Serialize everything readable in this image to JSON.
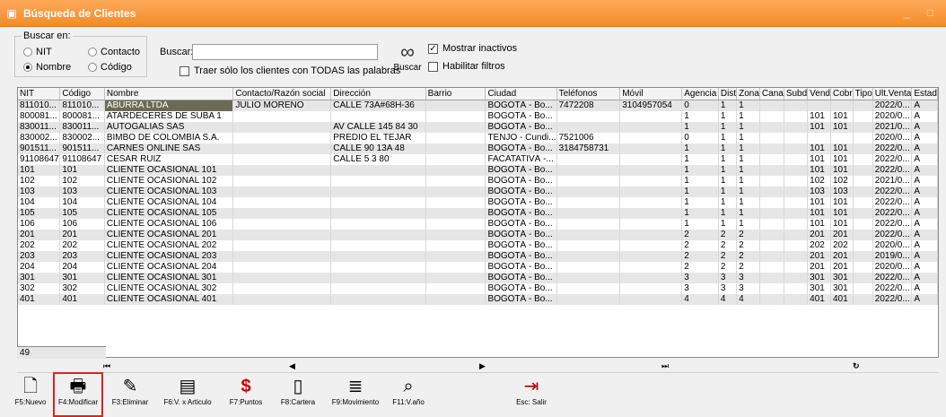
{
  "window": {
    "title": "Búsqueda de Clientes",
    "title_icon": "app-icon"
  },
  "search_panel": {
    "group_label": "Buscar en:",
    "options": [
      {
        "label": "NIT",
        "selected": false
      },
      {
        "label": "Nombre",
        "selected": true
      },
      {
        "label": "Contacto",
        "selected": false
      },
      {
        "label": "Código",
        "selected": false
      }
    ],
    "search_label": "Buscar:",
    "search_value": "",
    "all_words_label": "Traer sólo los clientes con TODAS las palabras",
    "search_button_label": "Buscar",
    "show_inactive_label": "Mostrar inactivos",
    "show_inactive_checked": true,
    "enable_filters_label": "Habilitar filtros",
    "enable_filters_checked": false
  },
  "grid": {
    "columns": [
      "NIT",
      "Código",
      "Nombre",
      "Contacto/Razón social",
      "Dirección",
      "Barrio",
      "Ciudad",
      "Teléfonos",
      "Móvil",
      "Agencia",
      "Dist",
      "Zona",
      "Cana",
      "Subd",
      "Vend",
      "Cobr",
      "Tipo",
      "Ult.Venta",
      "Estad"
    ],
    "rows": [
      [
        "811010...",
        "811010...",
        "ABURRA LTDA",
        "JULIO MORENO",
        "CALLE 73A#68H-36",
        "",
        "BOGOTÁ - Bo...",
        "7472208",
        "3104957054",
        "0",
        "1",
        "1",
        "",
        "",
        "",
        "",
        "",
        "2022/0...",
        "A"
      ],
      [
        "800081...",
        "800081...",
        "ATARDECERES DE SUBA 1",
        "",
        "",
        "",
        "BOGOTÁ - Bo...",
        "",
        "",
        "1",
        "1",
        "1",
        "",
        "",
        "101",
        "101",
        "",
        "2020/0...",
        "A"
      ],
      [
        "830011...",
        "830011...",
        "AUTOGALIAS SAS",
        "",
        "AV CALLE 145 84 30",
        "",
        "BOGOTÁ - Bo...",
        "",
        "",
        "1",
        "1",
        "1",
        "",
        "",
        "101",
        "101",
        "",
        "2021/0...",
        "A"
      ],
      [
        "830002...",
        "830002...",
        "BIMBO DE COLOMBIA S.A.",
        "",
        "PREDIO EL TEJAR",
        "",
        "TENJO - Cundi...",
        "7521006",
        "",
        "0",
        "1",
        "1",
        "",
        "",
        "",
        "",
        "",
        "2020/0...",
        "A"
      ],
      [
        "901511...",
        "901511...",
        "CARNES ONLINE SAS",
        "",
        "CALLE 90 13A 48",
        "",
        "BOGOTÁ - Bo...",
        "3184758731",
        "",
        "1",
        "1",
        "1",
        "",
        "",
        "101",
        "101",
        "",
        "2022/0...",
        "A"
      ],
      [
        "91108647",
        "91108647",
        "CESAR RUIZ",
        "",
        "CALLE 5 3 80",
        "",
        "FACATATIVÁ -...",
        "",
        "",
        "1",
        "1",
        "1",
        "",
        "",
        "101",
        "101",
        "",
        "2022/0...",
        "A"
      ],
      [
        "101",
        "101",
        "CLIENTE OCASIONAL 101",
        "",
        "",
        "",
        "BOGOTÁ - Bo...",
        "",
        "",
        "1",
        "1",
        "1",
        "",
        "",
        "101",
        "101",
        "",
        "2022/0...",
        "A"
      ],
      [
        "102",
        "102",
        "CLIENTE OCASIONAL 102",
        "",
        "",
        "",
        "BOGOTÁ - Bo...",
        "",
        "",
        "1",
        "1",
        "1",
        "",
        "",
        "102",
        "102",
        "",
        "2021/0...",
        "A"
      ],
      [
        "103",
        "103",
        "CLIENTE OCASIONAL 103",
        "",
        "",
        "",
        "BOGOTÁ - Bo...",
        "",
        "",
        "1",
        "1",
        "1",
        "",
        "",
        "103",
        "103",
        "",
        "2022/0...",
        "A"
      ],
      [
        "104",
        "104",
        "CLIENTE OCASIONAL 104",
        "",
        "",
        "",
        "BOGOTÁ - Bo...",
        "",
        "",
        "1",
        "1",
        "1",
        "",
        "",
        "101",
        "101",
        "",
        "2022/0...",
        "A"
      ],
      [
        "105",
        "105",
        "CLIENTE OCASIONAL 105",
        "",
        "",
        "",
        "BOGOTÁ - Bo...",
        "",
        "",
        "1",
        "1",
        "1",
        "",
        "",
        "101",
        "101",
        "",
        "2022/0...",
        "A"
      ],
      [
        "106",
        "106",
        "CLIENTE OCASIONAL 106",
        "",
        "",
        "",
        "BOGOTÁ - Bo...",
        "",
        "",
        "1",
        "1",
        "1",
        "",
        "",
        "101",
        "101",
        "",
        "2022/0...",
        "A"
      ],
      [
        "201",
        "201",
        "CLIENTE OCASIONAL 201",
        "",
        "",
        "",
        "BOGOTÁ - Bo...",
        "",
        "",
        "2",
        "2",
        "2",
        "",
        "",
        "201",
        "201",
        "",
        "2022/0...",
        "A"
      ],
      [
        "202",
        "202",
        "CLIENTE OCASIONAL 202",
        "",
        "",
        "",
        "BOGOTÁ - Bo...",
        "",
        "",
        "2",
        "2",
        "2",
        "",
        "",
        "202",
        "202",
        "",
        "2020/0...",
        "A"
      ],
      [
        "203",
        "203",
        "CLIENTE OCASIONAL 203",
        "",
        "",
        "",
        "BOGOTÁ - Bo...",
        "",
        "",
        "2",
        "2",
        "2",
        "",
        "",
        "201",
        "201",
        "",
        "2019/0...",
        "A"
      ],
      [
        "204",
        "204",
        "CLIENTE OCASIONAL 204",
        "",
        "",
        "",
        "BOGOTÁ - Bo...",
        "",
        "",
        "2",
        "2",
        "2",
        "",
        "",
        "201",
        "201",
        "",
        "2020/0...",
        "A"
      ],
      [
        "301",
        "301",
        "CLIENTE OCASIONAL 301",
        "",
        "",
        "",
        "BOGOTÁ - Bo...",
        "",
        "",
        "3",
        "3",
        "3",
        "",
        "",
        "301",
        "301",
        "",
        "2022/0...",
        "A"
      ],
      [
        "302",
        "302",
        "CLIENTE OCASIONAL 302",
        "",
        "",
        "",
        "BOGOTÁ - Bo...",
        "",
        "",
        "3",
        "3",
        "3",
        "",
        "",
        "301",
        "301",
        "",
        "2022/0...",
        "A"
      ],
      [
        "401",
        "401",
        "CLIENTE OCASIONAL 401",
        "",
        "",
        "",
        "BOGOTÁ - Bo...",
        "",
        "",
        "4",
        "4",
        "4",
        "",
        "",
        "401",
        "401",
        "",
        "2022/0...",
        "A"
      ]
    ],
    "record_count": "49"
  },
  "nav": {
    "first": "⏮",
    "prev": "◀",
    "next": "▶",
    "last": "⏭",
    "refresh": "↻"
  },
  "toolbar": [
    {
      "label": "F5:Nuevo",
      "icon": "new-doc-icon",
      "glyph": "🗋"
    },
    {
      "label": "F4:Modificar",
      "icon": "printer-icon",
      "glyph": "🖶"
    },
    {
      "label": "F3:Eliminar",
      "icon": "eraser-icon",
      "glyph": "✎"
    },
    {
      "label": "F6:V. x Articulo",
      "icon": "cash-register-icon",
      "glyph": "▤"
    },
    {
      "label": "F7:Puntos",
      "icon": "dollar-icon",
      "glyph": "$"
    },
    {
      "label": "F8:Cartera",
      "icon": "ledger-icon",
      "glyph": "▯"
    },
    {
      "label": "F9:Movimiento",
      "icon": "list-icon",
      "glyph": "≣"
    },
    {
      "label": "F11:V.año",
      "icon": "magnifier-chart-icon",
      "glyph": "⌕"
    },
    {
      "label": "Esc: Salir",
      "icon": "exit-door-icon",
      "glyph": "⇥"
    }
  ]
}
